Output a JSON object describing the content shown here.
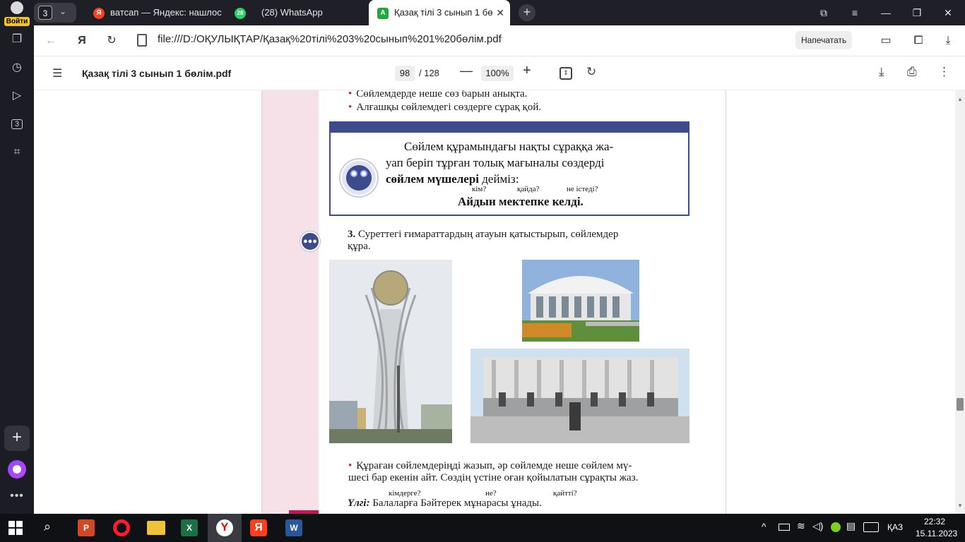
{
  "sidebar": {
    "login_label": "Войти",
    "tab_count_badge": "3",
    "icons": [
      "collections-icon",
      "history-icon",
      "video-icon",
      "tabs-count-icon",
      "screenshot-icon"
    ]
  },
  "tabs": {
    "group_count": "3",
    "items": [
      {
        "label": "ватсап — Яндекс: нашлос",
        "favicon": "Я",
        "color": "#fc3f1d"
      },
      {
        "label": "(28) WhatsApp",
        "favicon": "28",
        "color": "#25d366"
      },
      {
        "label": "Қазақ тілі 3 сынып 1 бө",
        "favicon": "A",
        "color": "#22a83a"
      }
    ]
  },
  "address": {
    "url": "file:///D:/ОҚУЛЫҚТАР/Қазақ%20тілі%203%20сынып%201%20бөлім.pdf",
    "print_button": "Напечатать"
  },
  "pdf": {
    "title": "Қазақ тілі 3 сынып 1 бөлім.pdf",
    "page_current": "98",
    "page_total": "/ 128",
    "zoom": "100%"
  },
  "page": {
    "line_top": "Сөйлемдерде неше сөз барын анықта.",
    "bullet_2": "Алғашқы сөйлемдегі сөздерге сұрақ қой.",
    "def_line1": "Сөйлем құрамындағы нақты сұраққа жа-",
    "def_line2": "уап беріп тұрған толық мағыналы сөздерді",
    "def_bold": "сөйлем мүшелері",
    "def_end": " дейміз:",
    "q1": "кім?",
    "q2": "қайда?",
    "q3": "не істеді?",
    "example": "Айдын мектепке келді.",
    "task_num": "3.",
    "task_line1": " Суреттегі ғимараттардың атауын қатыстырып, сөйлемдер",
    "task_line2": "құра.",
    "bullet_3_line1": "Құраған сөйлемдеріңді жазып, әр сөйлемде неше сөйлем мү-",
    "bullet_3_line2": "шесі бар екенін айт. Сөздің үстіне оған қойылатын сұрақты жаз.",
    "sq1": "кімдерге?",
    "sq2": "не?",
    "sq3": "қайтті?",
    "sample_label": "Үлгі:",
    "sample_text": " Балаларға Бәйтерек мұнарасы ұнады."
  },
  "taskbar": {
    "lang": "ҚАЗ",
    "time": "22:32",
    "date": "15.11.2023"
  }
}
